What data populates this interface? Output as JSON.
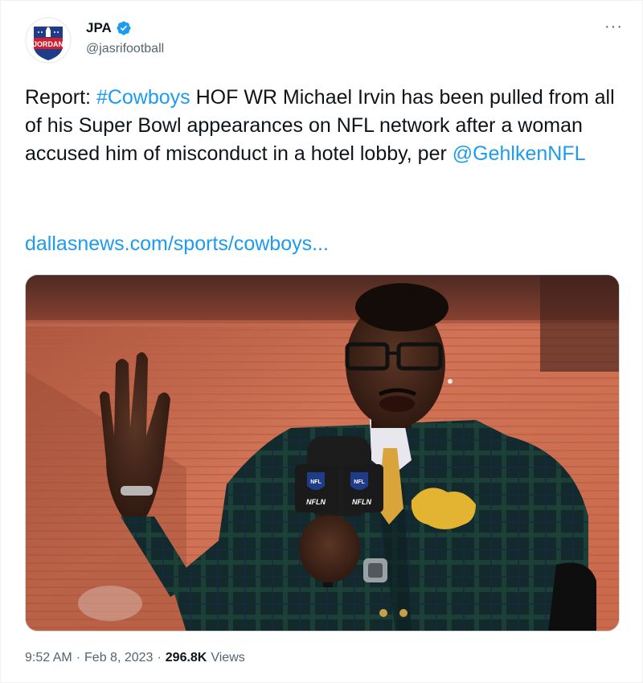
{
  "author": {
    "display_name": "JPA",
    "handle": "@jasrifootball",
    "avatar_text": "JORDAN",
    "verified": true
  },
  "tweet": {
    "text_prefix": "Report: ",
    "hashtag": "#Cowboys",
    "text_middle": " HOF WR Michael Irvin has been pulled from all of his Super Bowl appearances on NFL network after a woman accused him of misconduct in a hotel lobby, per ",
    "mention": "@GehlkenNFL",
    "url": "dallasnews.com/sports/cowboys..."
  },
  "media": {
    "microphone_flag_text": "NFLN",
    "shield_text": "NFL"
  },
  "meta": {
    "time": "9:52 AM",
    "separator": "·",
    "date": "Feb 8, 2023",
    "views_count": "296.8K",
    "views_label": "Views"
  },
  "colors": {
    "link": "#1d9bf0",
    "text": "#0f1419",
    "secondary": "#536471",
    "verified": "#1d9bf0"
  },
  "icons": {
    "more": "more-icon",
    "verified": "verified-badge-icon"
  }
}
